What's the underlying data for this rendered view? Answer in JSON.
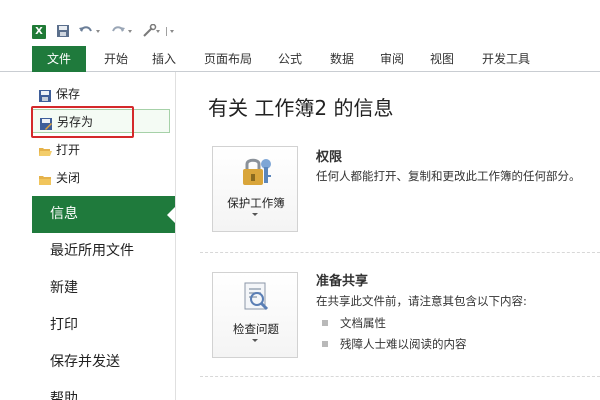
{
  "app": {
    "logo_letter": "X",
    "brand_color": "#1f7a3c"
  },
  "quick_access": {
    "save_icon": "save-icon",
    "undo_icon": "undo-icon",
    "redo_icon": "redo-icon",
    "customize_icon": "customize-icon"
  },
  "ribbon": {
    "tabs": [
      {
        "label": "文件"
      },
      {
        "label": "开始"
      },
      {
        "label": "插入"
      },
      {
        "label": "页面布局"
      },
      {
        "label": "公式"
      },
      {
        "label": "数据"
      },
      {
        "label": "审阅"
      },
      {
        "label": "视图"
      },
      {
        "label": "开发工具"
      }
    ]
  },
  "backstage": {
    "commands": [
      {
        "label": "保存",
        "icon": "save-icon"
      },
      {
        "label": "另存为",
        "icon": "save-as-icon"
      },
      {
        "label": "打开",
        "icon": "folder-open-icon"
      },
      {
        "label": "关闭",
        "icon": "folder-close-icon"
      }
    ],
    "nav": [
      {
        "label": "信息",
        "active": true
      },
      {
        "label": "最近所用文件"
      },
      {
        "label": "新建"
      },
      {
        "label": "打印"
      },
      {
        "label": "保存并发送"
      },
      {
        "label": "帮助"
      }
    ]
  },
  "info": {
    "title": "有关 工作簿2 的信息",
    "permissions": {
      "button_label": "保护工作簿",
      "heading": "权限",
      "description": "任何人都能打开、复制和更改此工作簿的任何部分。"
    },
    "prepare_sharing": {
      "button_label": "检查问题",
      "heading": "准备共享",
      "description": "在共享此文件前，请注意其包含以下内容:",
      "bullets": [
        "文档属性",
        "残障人士难以阅读的内容"
      ]
    }
  }
}
